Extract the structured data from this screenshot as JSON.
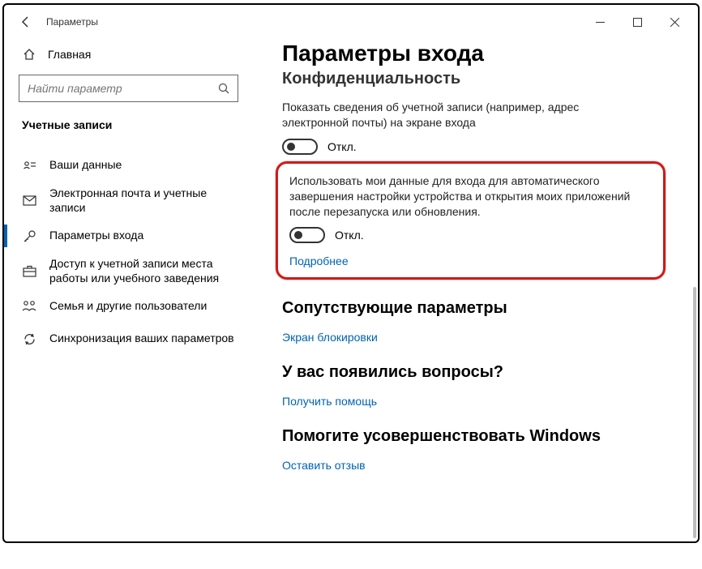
{
  "window": {
    "title": "Параметры"
  },
  "sidebar": {
    "home_label": "Главная",
    "search_placeholder": "Найти параметр",
    "section_label": "Учетные записи",
    "items": [
      {
        "icon": "user-card-icon",
        "label": "Ваши данные"
      },
      {
        "icon": "mail-icon",
        "label": "Электронная почта и учетные записи"
      },
      {
        "icon": "key-icon",
        "label": "Параметры входа"
      },
      {
        "icon": "briefcase-icon",
        "label": "Доступ к учетной записи места работы или учебного заведения"
      },
      {
        "icon": "family-icon",
        "label": "Семья и другие пользователи"
      },
      {
        "icon": "sync-icon",
        "label": "Синхронизация ваших параметров"
      }
    ]
  },
  "main": {
    "page_title": "Параметры входа",
    "privacy_heading_cut": "Конфиденциальность",
    "privacy": {
      "text": "Показать сведения об учетной записи (например, адрес электронной почты) на экране входа",
      "state": "Откл."
    },
    "usedata": {
      "text": "Использовать мои данные для входа для автоматического завершения настройки устройства и открытия моих приложений после перезапуска или обновления.",
      "state": "Откл.",
      "more_link": "Подробнее"
    },
    "related": {
      "heading": "Сопутствующие параметры",
      "link": "Экран блокировки"
    },
    "questions": {
      "heading": "У вас появились вопросы?",
      "link": "Получить помощь"
    },
    "feedback": {
      "heading": "Помогите усовершенствовать Windows",
      "link": "Оставить отзыв"
    }
  }
}
